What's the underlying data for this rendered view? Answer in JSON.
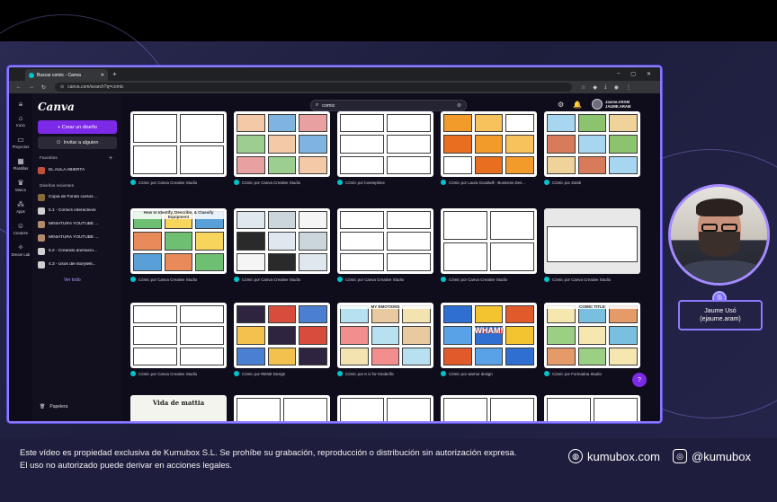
{
  "browser": {
    "tab_title": "Buscar comic - Canva",
    "url": "canva.com/search?q=comic",
    "window_controls": [
      "–",
      "▢",
      "✕"
    ]
  },
  "sidebar_nav": [
    {
      "icon": "home-icon",
      "glyph": "⌂",
      "label": "Inicio"
    },
    {
      "icon": "folder-icon",
      "glyph": "▭",
      "label": "Proyectos"
    },
    {
      "icon": "templates-icon",
      "glyph": "▦",
      "label": "Plantillas"
    },
    {
      "icon": "brand-icon",
      "glyph": "♛",
      "label": "Marca"
    },
    {
      "icon": "apps-icon",
      "glyph": "⁂",
      "label": "Apps"
    },
    {
      "icon": "creators-icon",
      "glyph": "☺",
      "label": "Creators"
    },
    {
      "icon": "dreamlab-icon",
      "glyph": "✧",
      "label": "Dream Lab"
    }
  ],
  "panel": {
    "logo": "Canva",
    "create_label": "+ Crear un diseño",
    "invite_label": "Invitar a alguien",
    "favorites_title": "Favoritos",
    "favorites": [
      "EL AULA ABIERTA"
    ],
    "recent_title": "Diseños recientes",
    "recent": [
      "Copia de Fondo cursos ...",
      "5.1 - Cómics interactivos",
      "MINIATURA YOUTUBE ...",
      "MINIATURA YOUTUBE ...",
      "5.2 - Creando animacio...",
      "4.3 - Usos del storytelli..."
    ],
    "see_all": "Ver todo",
    "trash": "Papelera"
  },
  "search": {
    "value": "comic"
  },
  "user": {
    "name": "Jaume.ARAM",
    "sub": "JAUME.ARAM"
  },
  "results": [
    {
      "caption": "Cómic por Canva Creative Studio",
      "style": "empty-panels"
    },
    {
      "caption": "Cómic por Canva Creative Studio",
      "style": "people"
    },
    {
      "caption": "Cómic por lonetephine",
      "style": "bubbles"
    },
    {
      "caption": "Cómic por Laura Goodwill - Business Des...",
      "style": "orange"
    },
    {
      "caption": "Cómic por Zulati",
      "style": "outdoor"
    },
    {
      "caption": "Cómic por Canva Creative Studio",
      "style": "kids-grid",
      "title": "How to Identify, Describe, & Classify Equipment"
    },
    {
      "caption": "Cómic por Canva Creative Studio",
      "style": "penguins"
    },
    {
      "caption": "Cómic por Canva Creative Studio",
      "style": "sketch"
    },
    {
      "caption": "Cómic por Canva Creative Studio",
      "style": "blank-panels"
    },
    {
      "caption": "Cómic por Canva Creative Studio",
      "style": "blank-wide"
    },
    {
      "caption": "Cómic por Canva Creative Studio",
      "style": "sketch-bubble"
    },
    {
      "caption": "Cómic por RENE Design",
      "style": "hero-night"
    },
    {
      "caption": "Cómic por K is for Kinderific",
      "style": "emotions",
      "title": "MY EMOTIONS"
    },
    {
      "caption": "Cómic por warrior design",
      "style": "pop-art",
      "title": "WHAM!"
    },
    {
      "caption": "Cómic por Formadoa Studio",
      "style": "classroom",
      "title": "COMIC TITLE"
    },
    {
      "caption": "",
      "style": "vida",
      "title": "Vida de mattia"
    },
    {
      "caption": "",
      "style": "blank-panels"
    },
    {
      "caption": "",
      "style": "blank-panels"
    },
    {
      "caption": "",
      "style": "blank-panels"
    },
    {
      "caption": "",
      "style": "blank-panels"
    }
  ],
  "help": "?",
  "presenter": {
    "name": "Jaume Usó",
    "handle": "(ejaume.aram)"
  },
  "footer": {
    "legal": "Este vídeo es propiedad exclusiva de Kumubox S.L. Se prohíbe su grabación, reproducción o distribución sin autorización expresa. El uso no autorizado puede derivar en acciones legales.",
    "website": "kumubox.com",
    "social": "@kumubox"
  },
  "colors": {
    "accent": "#7d2ae8",
    "frame": "#8b7bff",
    "footer": "#1e1d3d"
  }
}
